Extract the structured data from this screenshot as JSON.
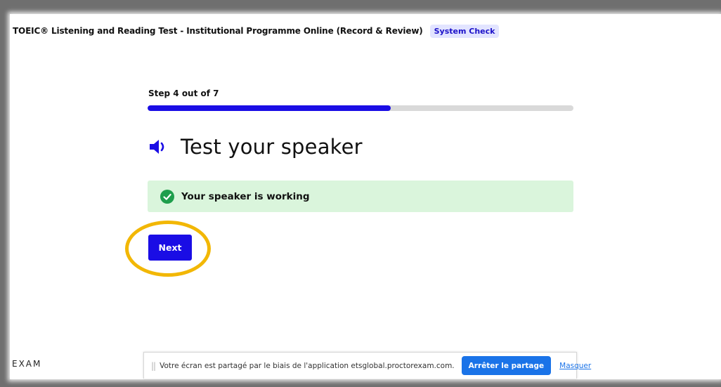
{
  "header": {
    "title": "TOEIC® Listening and Reading Test - Institutional Programme Online (Record & Review)",
    "badge": "System Check"
  },
  "step": {
    "label": "Step 4 out of 7",
    "progress_fraction": 0.571
  },
  "main": {
    "title": "Test your speaker",
    "title_icon": "speaker-volume-icon",
    "status_icon": "check-circle-icon",
    "status_text": "Your speaker is working",
    "next_label": "Next"
  },
  "footer": {
    "brand": "EXAM"
  },
  "share_bar": {
    "handle": "||",
    "message": "Votre écran est partagé par le biais de l'application etsglobal.proctorexam.com.",
    "stop_label": "Arrêter le partage",
    "hide_label": "Masquer"
  },
  "colors": {
    "accent": "#1a0de5",
    "status_bg": "#daf5dc",
    "success": "#1e9e4c",
    "highlight": "#f2b705",
    "badge_bg": "#e2e4ff",
    "share_button": "#1a73e8"
  }
}
